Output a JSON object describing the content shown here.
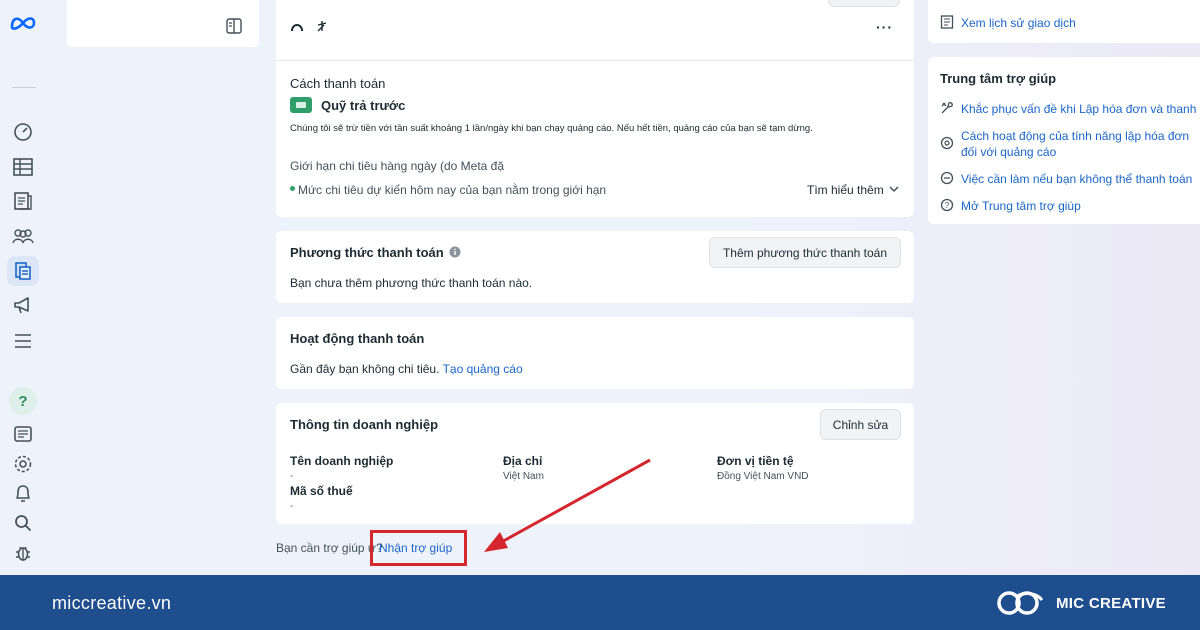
{
  "icons": {
    "rail": [
      "meta-logo",
      "dashboard-icon",
      "table-icon",
      "pages-icon",
      "audience-icon",
      "billing-icon",
      "megaphone-icon",
      "menu-icon",
      "help-icon",
      "news-icon",
      "settings-icon",
      "bell-icon",
      "search-icon",
      "bug-icon"
    ]
  },
  "payment_method_card": {
    "heading": "Cách thanh toán",
    "method_name": "Quỹ trả trước",
    "description": "Chúng tôi sẽ trừ tiền với tần suất khoảng 1 lần/ngày khi bạn chạy quảng cáo. Nếu hết tiền, quảng cáo của bạn sẽ tạm dừng.",
    "daily_limit_label": "Giới hạn chi tiêu hàng ngày (do Meta đặ",
    "status_text": "Mức chi tiêu dự kiến hôm nay của bạn nằm trong giới hạn",
    "learn_more": "Tìm hiểu thêm",
    "more_icon_label": "···"
  },
  "payment_methods": {
    "title": "Phương thức thanh toán",
    "add_button": "Thêm phương thức thanh toán",
    "empty_text": "Bạn chưa thêm phương thức thanh toán nào."
  },
  "payment_activity": {
    "title": "Hoạt động thanh toán",
    "text": "Gần đây bạn không chi tiêu.",
    "link": "Tạo quảng cáo"
  },
  "business_info": {
    "title": "Thông tin doanh nghiệp",
    "edit_button": "Chỉnh sửa",
    "fields": [
      {
        "label": "Tên doanh nghiệp",
        "value": "-"
      },
      {
        "label": "Địa chỉ",
        "value": "Việt Nam"
      },
      {
        "label": "Đơn vị tiền tệ",
        "value": "Đồng Việt Nam VND"
      },
      {
        "label": "Mã số thuế",
        "value": "-"
      }
    ]
  },
  "help_prompt": {
    "text": "Bạn cần trợ giúp ư?",
    "link": "Nhận trợ giúp"
  },
  "right_panel": {
    "history_link": "Xem lịch sử giao dịch",
    "help_center_title": "Trung tâm trợ giúp",
    "links": [
      "Khắc phục vấn đề khi Lập hóa đơn và thanh toán",
      "Cách hoạt động của tính năng lập hóa đơn đối với quảng cáo",
      "Việc cần làm nếu bạn không thể thanh toán",
      "Mở Trung tâm trợ giúp"
    ]
  },
  "footer": {
    "site": "miccreative.vn",
    "brand": "MIC CREATIVE"
  },
  "colors": {
    "accent": "#1b66c9",
    "annotation": "#d6262d",
    "footer": "#1f4e8f",
    "green": "#2e9e6a"
  }
}
